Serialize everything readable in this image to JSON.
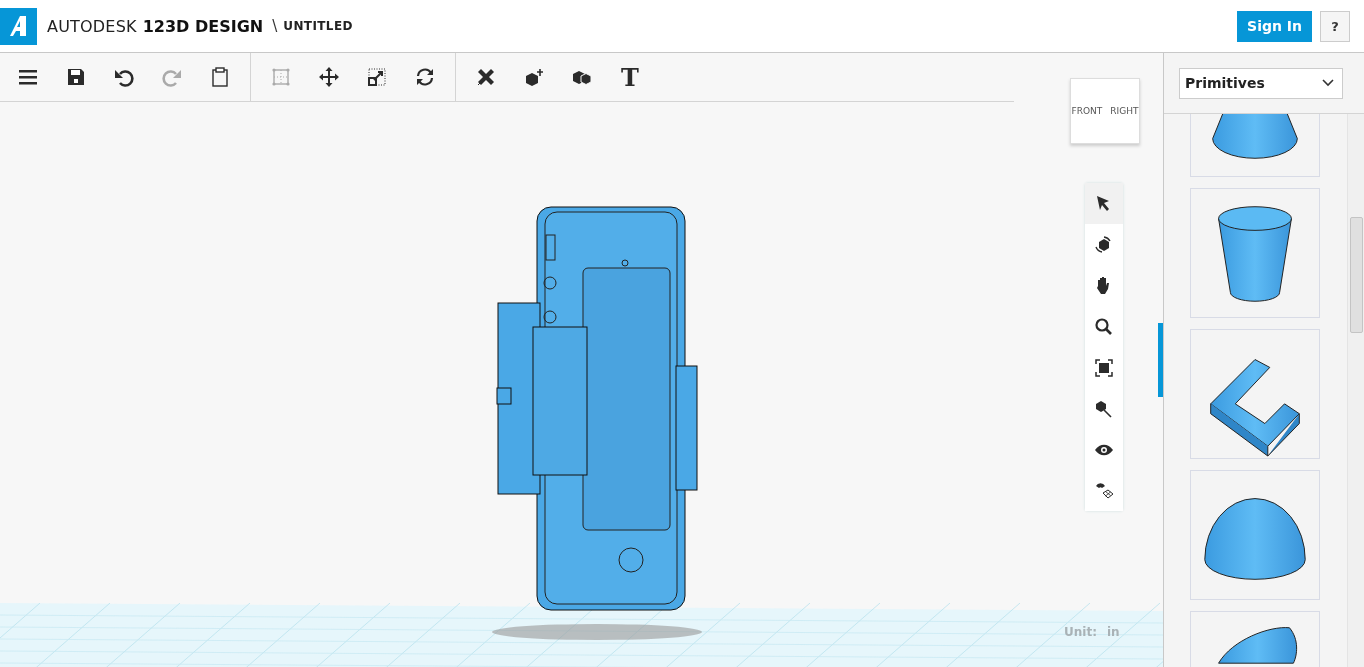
{
  "header": {
    "brand": "AUTODESK",
    "product": "123D DESIGN",
    "path_separator": "\\",
    "document_title": "UNTITLED",
    "buttons": [
      {
        "kind": "sign_in",
        "label": "Sign In"
      },
      {
        "kind": "help",
        "label": "?"
      }
    ]
  },
  "toolbar": {
    "groups": [
      [
        {
          "kind": "menu",
          "disabled": false
        },
        {
          "kind": "save",
          "disabled": false
        },
        {
          "kind": "undo",
          "disabled": false
        },
        {
          "kind": "redo",
          "disabled": true
        },
        {
          "kind": "clipboard",
          "disabled": false
        }
      ],
      [
        {
          "kind": "select_box",
          "disabled": true
        },
        {
          "kind": "move",
          "disabled": false
        },
        {
          "kind": "scale",
          "disabled": false
        },
        {
          "kind": "refresh",
          "disabled": false
        }
      ],
      [
        {
          "kind": "ruler",
          "disabled": false
        },
        {
          "kind": "box_move",
          "disabled": false
        },
        {
          "kind": "boxes",
          "disabled": false
        },
        {
          "kind": "text",
          "label": "T",
          "disabled": false
        }
      ]
    ]
  },
  "view_cube": {
    "front": "FRONT",
    "right": "RIGHT"
  },
  "nav_tools": [
    {
      "kind": "pointer",
      "selected": true
    },
    {
      "kind": "orbit",
      "selected": false
    },
    {
      "kind": "pan",
      "selected": false
    },
    {
      "kind": "zoom",
      "selected": false
    },
    {
      "kind": "fit",
      "selected": false
    },
    {
      "kind": "zoom_selected",
      "selected": false
    },
    {
      "kind": "visibility",
      "selected": false
    },
    {
      "kind": "snap",
      "selected": false
    }
  ],
  "unit": {
    "label": "Unit:",
    "value": "in"
  },
  "panel": {
    "dropdown": "Primitives",
    "shapes": [
      {
        "kind": "cone"
      },
      {
        "kind": "cylinder"
      },
      {
        "kind": "bracket"
      },
      {
        "kind": "hemisphere"
      },
      {
        "kind": "paraboloid"
      }
    ]
  }
}
